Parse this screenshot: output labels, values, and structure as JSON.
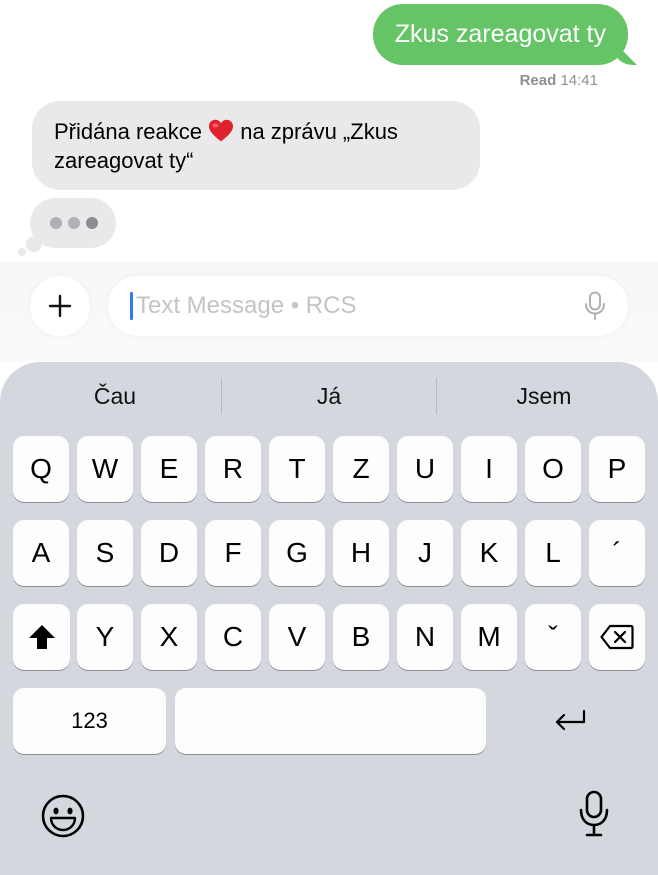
{
  "thread": {
    "outgoing": {
      "text": "Zkus zareagovat ty"
    },
    "receipt": {
      "label": "Read",
      "time": "14:41"
    },
    "incoming": {
      "text_before": "Přidána reakce ",
      "reaction_icon": "red-heart-emoji",
      "text_after": " na zprávu „Zkus zareagovat ty“"
    },
    "typing_indicator": {
      "dots": 3
    }
  },
  "composer": {
    "plus_icon": "plus-icon",
    "placeholder": "Text Message • RCS",
    "value": "",
    "mic_icon": "microphone-icon"
  },
  "keyboard": {
    "suggestions": [
      "Čau",
      "Já",
      "Jsem"
    ],
    "row1": [
      "Q",
      "W",
      "E",
      "R",
      "T",
      "Z",
      "U",
      "I",
      "O",
      "P"
    ],
    "row2": [
      "A",
      "S",
      "D",
      "F",
      "G",
      "H",
      "J",
      "K",
      "L",
      "´"
    ],
    "row3": [
      "Y",
      "X",
      "C",
      "V",
      "B",
      "N",
      "M",
      "ˇ"
    ],
    "shift_icon": "shift-icon",
    "delete_icon": "backspace-icon",
    "numbers_label": "123",
    "return_icon": "return-icon",
    "emoji_icon": "emoji-icon",
    "dictation_icon": "microphone-icon"
  },
  "colors": {
    "outgoing_bubble": "#65c466",
    "incoming_bubble": "#e9e9eb",
    "keyboard_bg": "#d4d7dd",
    "caret": "#3478f6"
  }
}
